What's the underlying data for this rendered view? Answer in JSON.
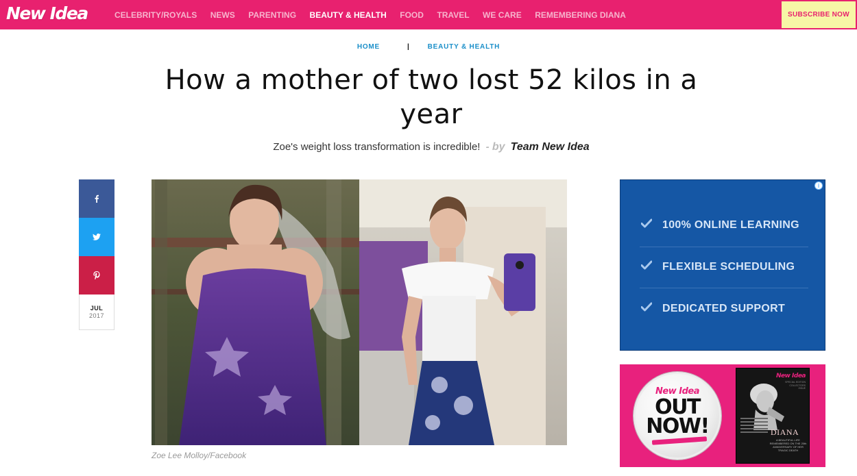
{
  "site": {
    "logo": "New Idea",
    "nav": [
      {
        "label": "CELEBRITY/ROYALS",
        "active": false
      },
      {
        "label": "NEWS",
        "active": false
      },
      {
        "label": "PARENTING",
        "active": false
      },
      {
        "label": "BEAUTY & HEALTH",
        "active": true
      },
      {
        "label": "FOOD",
        "active": false
      },
      {
        "label": "TRAVEL",
        "active": false
      },
      {
        "label": "WE CARE",
        "active": false
      },
      {
        "label": "REMEMBERING DIANA",
        "active": false
      }
    ],
    "subscribe_label": "SUBSCRIBE NOW"
  },
  "breadcrumb": {
    "home": "HOME",
    "separator": "|",
    "section": "BEAUTY & HEALTH"
  },
  "article": {
    "title": "How a mother of two lost 52 kilos in a year",
    "subtitle": "Zoe's weight loss transformation is incredible!",
    "byline_dash": "-",
    "byline_prefix": "by",
    "author": "Team New Idea",
    "image_caption": "Zoe Lee Molloy/Facebook",
    "date_month": "JUL",
    "date_year": "2017"
  },
  "share": {
    "icons": [
      "facebook-icon",
      "twitter-icon",
      "pinterest-icon"
    ]
  },
  "ad_blue": {
    "info_glyph": "i",
    "items": [
      "100% ONLINE LEARNING",
      "FLEXIBLE SCHEDULING",
      "DEDICATED SUPPORT"
    ]
  },
  "ad_pink": {
    "logo": "New Idea",
    "line1": "OUT",
    "line2": "NOW!",
    "mag_logo": "New Idea",
    "mag_title": "DIANA",
    "mag_subtitle": "A BEAUTIFUL LIFE REMEMBERED ON THE 20th ANNIVERSARY OF HER TRAGIC DEATH",
    "mag_corner": "SPECIAL EDITION COLLECTORS ISSUE"
  },
  "colors": {
    "brand_pink": "#e8216f",
    "link_blue": "#1b8fc9",
    "subscribe_bg": "#f7f6a6",
    "facebook": "#3b5998",
    "twitter": "#1da1f2",
    "pinterest": "#cb1f47",
    "ad_blue": "#1557a5"
  }
}
